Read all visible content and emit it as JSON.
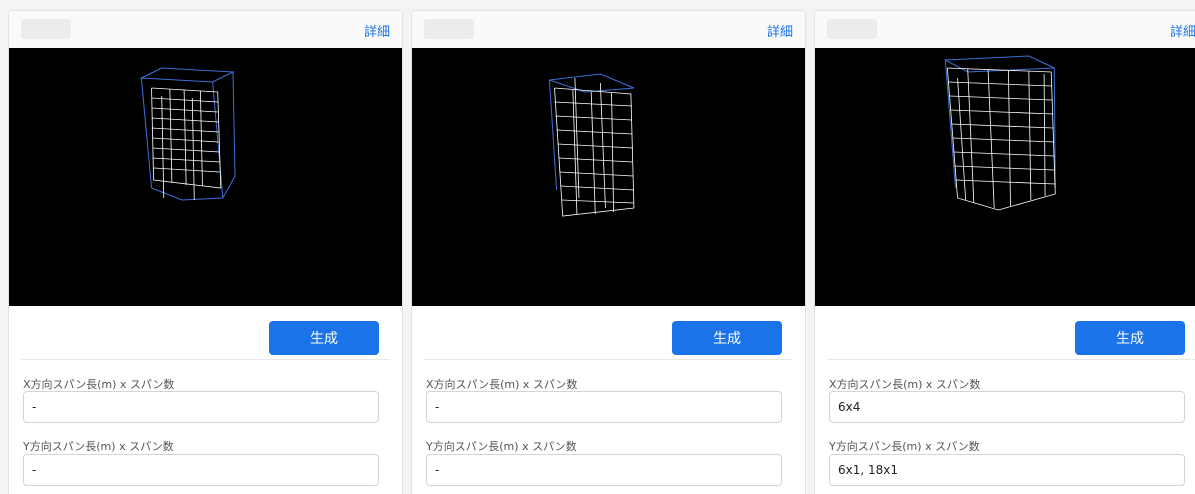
{
  "cards": [
    {
      "detail_label": "詳細",
      "generate_label": "生成",
      "x_span": {
        "label": "X方向スパン長(m) x スパン数",
        "value": "-"
      },
      "y_span": {
        "label": "Y方向スパン長(m) x スパン数",
        "value": "-"
      }
    },
    {
      "detail_label": "詳細",
      "generate_label": "生成",
      "x_span": {
        "label": "X方向スパン長(m) x スパン数",
        "value": "-"
      },
      "y_span": {
        "label": "Y方向スパン長(m) x スパン数",
        "value": "-"
      }
    },
    {
      "detail_label": "詳細",
      "generate_label": "生成",
      "x_span": {
        "label": "X方向スパン長(m) x スパン数",
        "value": "6x4"
      },
      "y_span": {
        "label": "Y方向スパン長(m) x スパン数",
        "value": "6x1, 18x1"
      }
    }
  ],
  "colors": {
    "accent": "#1a73e8",
    "viewer_background": "#000000",
    "wireframe": "#ffffff",
    "bounding_box": "#3d6fd8"
  }
}
